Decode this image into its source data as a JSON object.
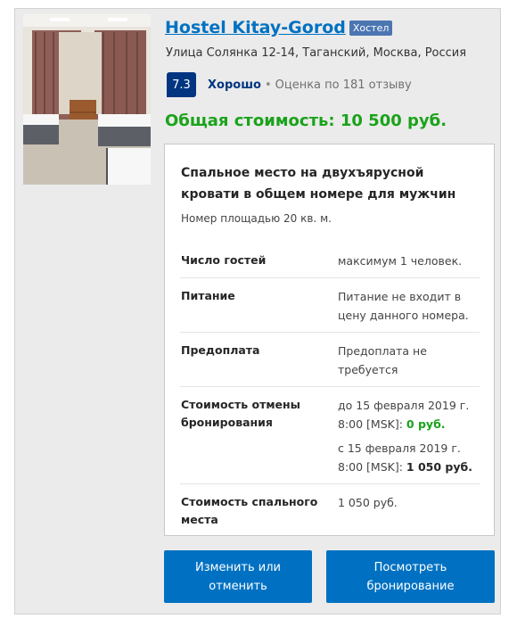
{
  "hotel": {
    "name": "Hostel Kitay-Gorod",
    "type_badge": "Хостел",
    "address": "Улица Солянка 12-14, Таганский, Москва, Россия",
    "photo_icon": "room-photo"
  },
  "rating": {
    "score": "7.3",
    "word": "Хорошо",
    "separator": "•",
    "reviews": "Оценка по 181 отзыву"
  },
  "total": "Общая стоимость: 10 500 руб.",
  "room": {
    "title": "Спальное место на двухъярусной кровати в общем номере для мужчин",
    "area": "Номер площадью 20 кв. м.",
    "rows": [
      {
        "label": "Число гостей",
        "value": "максимум 1 человек."
      },
      {
        "label": "Питание",
        "value": "Питание не входит в цену данного номера."
      },
      {
        "label": "Предоплата",
        "value": "Предоплата не требуется"
      },
      {
        "label": "Стоимость отмены бронирования",
        "cancel_1_text": "до 15 февраля 2019 г. 8:00 [MSK]:",
        "cancel_1_price": "0 руб.",
        "cancel_2_text": "с 15 февраля 2019 г. 8:00 [MSK]:",
        "cancel_2_price": "1 050 руб."
      },
      {
        "label": "Стоимость спального места",
        "value": "1 050 руб."
      }
    ]
  },
  "buttons": {
    "edit": "Изменить или отменить",
    "view": "Посмотреть бронирование"
  },
  "colors": {
    "accent": "#0071c2",
    "score_bg": "#003580",
    "price_green": "#1aa31a",
    "badge": "#4c76b2"
  }
}
